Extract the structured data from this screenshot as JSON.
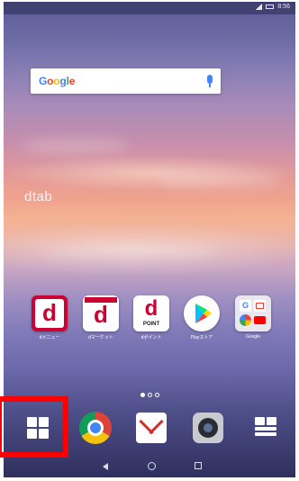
{
  "status_bar": {
    "time": "8:56"
  },
  "search_widget": {
    "logo_letters": [
      "G",
      "o",
      "o",
      "g",
      "l",
      "e"
    ],
    "logo_colors": [
      "#4285f4",
      "#ea4335",
      "#fbbc05",
      "#4285f4",
      "#34a853",
      "#ea4335"
    ]
  },
  "wallpaper_logo": "dtab",
  "apps": [
    {
      "name": "dメニュー",
      "label": "dメニュー",
      "icon": "d-menu-icon",
      "accent": "#cc0033"
    },
    {
      "name": "dマーケット",
      "label": "dマーケット",
      "icon": "d-market-icon",
      "accent": "#cc0033"
    },
    {
      "name": "dポイント",
      "label": "dポイント",
      "icon": "d-point-icon",
      "accent": "#cc0033",
      "sub": "POINT"
    },
    {
      "name": "Playストア",
      "label": "Playストア",
      "icon": "play-store-icon"
    },
    {
      "name": "Google",
      "label": "Google",
      "icon": "google-folder-icon"
    }
  ],
  "pager": {
    "pages": 3,
    "current": 1
  },
  "dock": [
    {
      "icon": "app-drawer-icon"
    },
    {
      "icon": "chrome-icon"
    },
    {
      "icon": "mail-icon"
    },
    {
      "icon": "camera-icon"
    },
    {
      "icon": "widgets-icon"
    }
  ],
  "nav": {
    "icons": [
      "back-icon",
      "home-icon",
      "recents-icon"
    ]
  }
}
